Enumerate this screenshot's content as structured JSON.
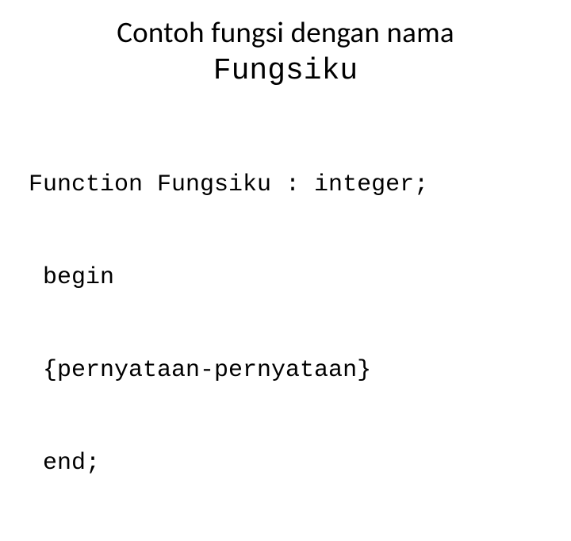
{
  "title": {
    "line1": "Contoh fungsi dengan nama",
    "line2_mono": "Fungsiku"
  },
  "code": {
    "line1": "Function Fungsiku : integer;",
    "line2": " begin",
    "line3": " {pernyataan-pernyataan}",
    "line4": " end;"
  }
}
